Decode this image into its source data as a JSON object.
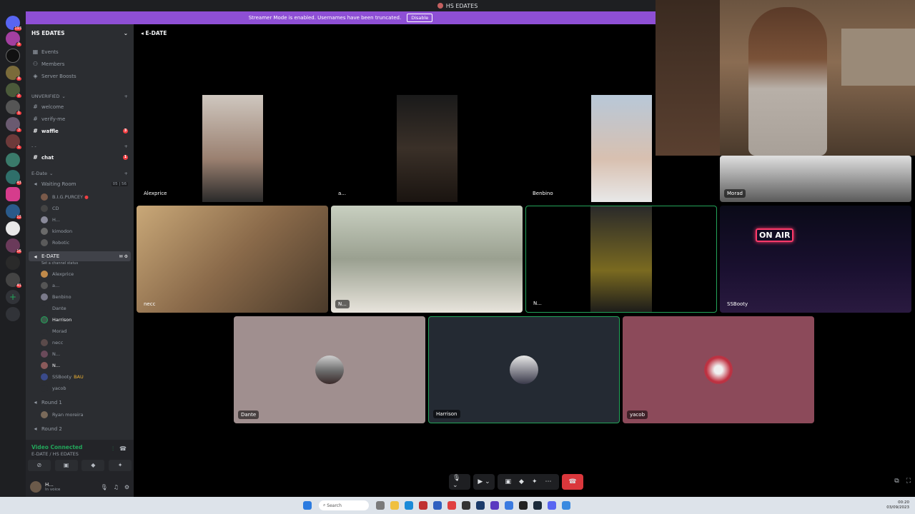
{
  "window": {
    "title": "HS EDATES"
  },
  "banner": {
    "text": "Streamer Mode is enabled. Usernames have been truncated.",
    "disable_label": "Disable"
  },
  "server": {
    "name": "HS EDATES",
    "top_items": [
      {
        "label": "Events",
        "icon": "calendar-icon"
      },
      {
        "label": "Members",
        "icon": "members-icon"
      },
      {
        "label": "Server Boosts",
        "icon": "boost-icon"
      }
    ],
    "category_unverified": "UNVERIFIED",
    "channels_unverified": [
      {
        "label": "welcome"
      },
      {
        "label": "verify-me"
      },
      {
        "label": "waffle",
        "badge": "3"
      }
    ],
    "category_dash": "- -",
    "channels_dash": [
      {
        "label": "chat",
        "badge": "1"
      }
    ],
    "category_edate": "E-Date",
    "waiting_room": {
      "label": "Waiting Room",
      "counter": "05 | 56"
    },
    "waiting_members": [
      "B.I.G.PURCEY",
      "CD",
      "H...",
      "kimodon",
      "Robotic"
    ],
    "edate_channel": {
      "label": "E-DATE",
      "status": "Set a channel status"
    },
    "edate_members": [
      "Alexprice",
      "a...",
      "Benbino",
      "Dante",
      "Harrison",
      "Morad",
      "necc",
      "N...",
      "N...",
      "SSBooty",
      "yacob"
    ],
    "edate_member_extra": {
      "ssbooty_tag": "BAU"
    },
    "round1": {
      "label": "Round 1",
      "member": "Ryan moreira"
    },
    "round2": {
      "label": "Round 2"
    }
  },
  "voice": {
    "status": "Video Connected",
    "location": "E-DATE / HS EDATES"
  },
  "user": {
    "name": "H...",
    "status": "In voice"
  },
  "main": {
    "channel_title": "E-DATE"
  },
  "tiles": {
    "alexprice": "Alexprice",
    "a": "a...",
    "benbino": "Benbino",
    "morad": "Morad",
    "necc": "necc",
    "n1": "N...",
    "n2": "N...",
    "ssbooty": "SSBooty",
    "dante": "Dante",
    "harrison": "Harrison",
    "yacob": "yacob"
  },
  "taskbar": {
    "search": "Search",
    "time": "00:20",
    "date": "03/09/2023"
  },
  "colors": {
    "accent": "#8e4fd5",
    "speaking": "#23a55a",
    "end_call": "#da373c"
  }
}
